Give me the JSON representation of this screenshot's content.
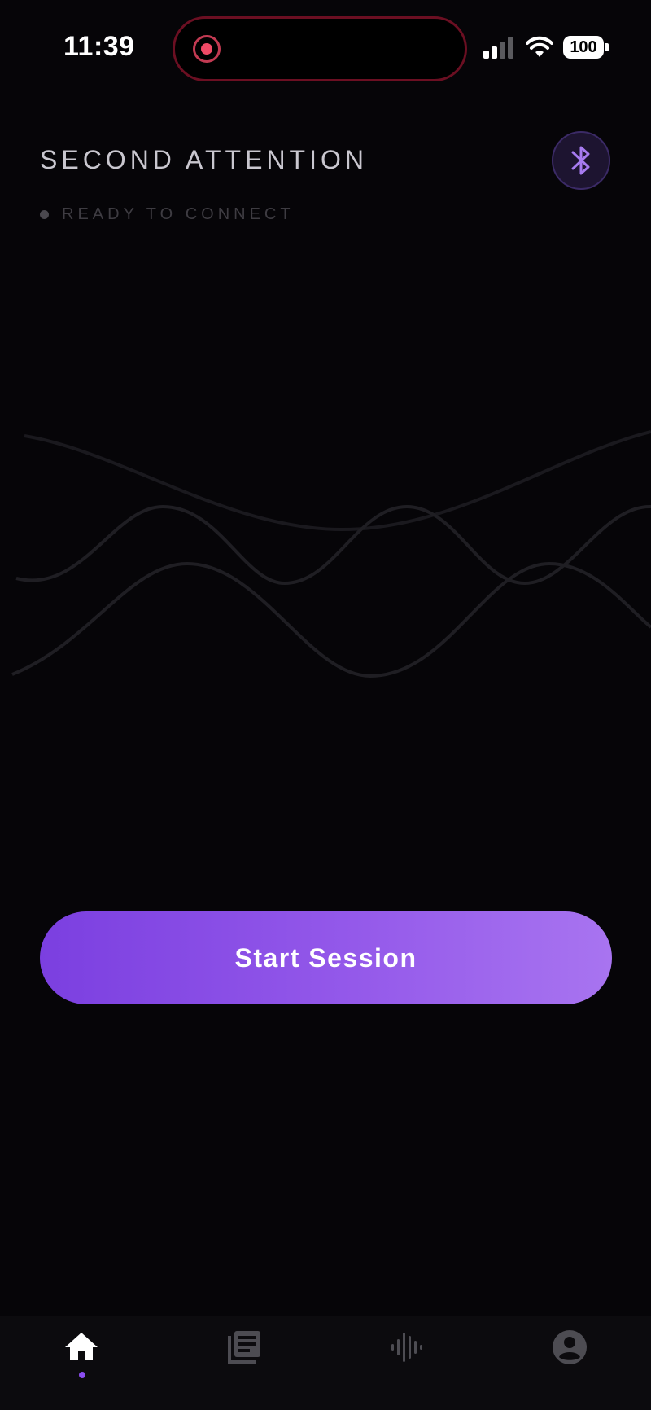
{
  "status_bar": {
    "time": "11:39",
    "battery": "100",
    "icons": [
      "recording-indicator-icon",
      "cellular-signal-icon",
      "wifi-icon",
      "battery-icon"
    ]
  },
  "header": {
    "title": "SECOND ATTENTION",
    "connection_status": "READY TO CONNECT",
    "bluetooth_icon": "bluetooth-icon"
  },
  "main": {
    "start_button_label": "Start Session"
  },
  "tab_bar": {
    "active": "home",
    "tabs": [
      {
        "id": "home",
        "icon": "home-icon"
      },
      {
        "id": "library",
        "icon": "library-icon"
      },
      {
        "id": "audio",
        "icon": "audio-wave-icon"
      },
      {
        "id": "profile",
        "icon": "profile-icon"
      }
    ]
  },
  "colors": {
    "background": "#060508",
    "accent": "#8b4df0",
    "button_gradient_start": "#7b3fe0",
    "button_gradient_end": "#a874f0",
    "recording": "#f04a66"
  }
}
